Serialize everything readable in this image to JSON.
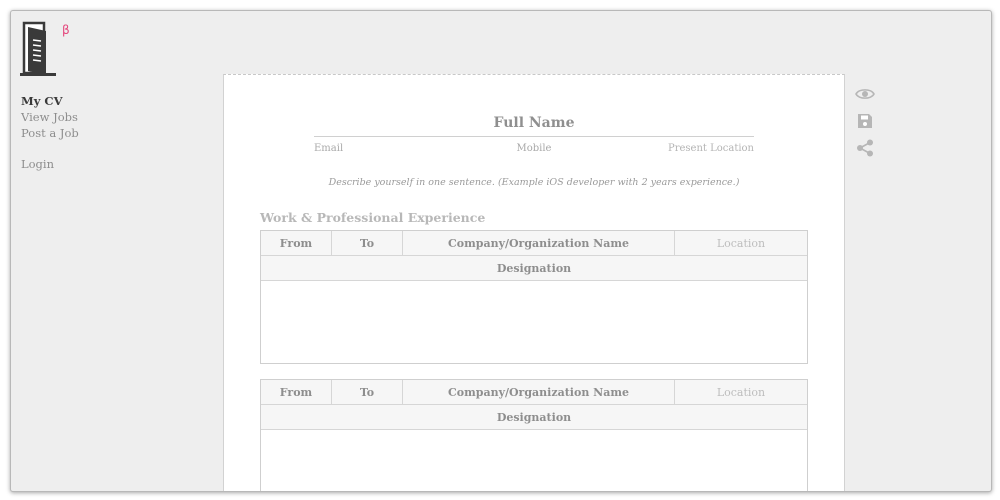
{
  "brand": {
    "badge": "β",
    "accent": "#e4457b"
  },
  "nav": {
    "items": [
      {
        "label": "My CV",
        "active": true
      },
      {
        "label": "View Jobs"
      },
      {
        "label": "Post a Job"
      }
    ],
    "login": "Login"
  },
  "cv": {
    "full_name": "Full Name",
    "email": "Email",
    "mobile": "Mobile",
    "location": "Present Location",
    "summary": "Describe yourself in one sentence. (Example iOS developer with 2 years experience.)",
    "section_title": "Work & Professional Experience",
    "jobs": [
      {
        "from": "From",
        "to": "To",
        "company": "Company/Organization Name",
        "location": "Location",
        "designation": "Designation"
      },
      {
        "from": "From",
        "to": "To",
        "company": "Company/Organization Name",
        "location": "Location",
        "designation": "Designation"
      }
    ]
  },
  "toolbar": {
    "icons": [
      "eye-icon",
      "save-icon",
      "share-icon"
    ]
  }
}
